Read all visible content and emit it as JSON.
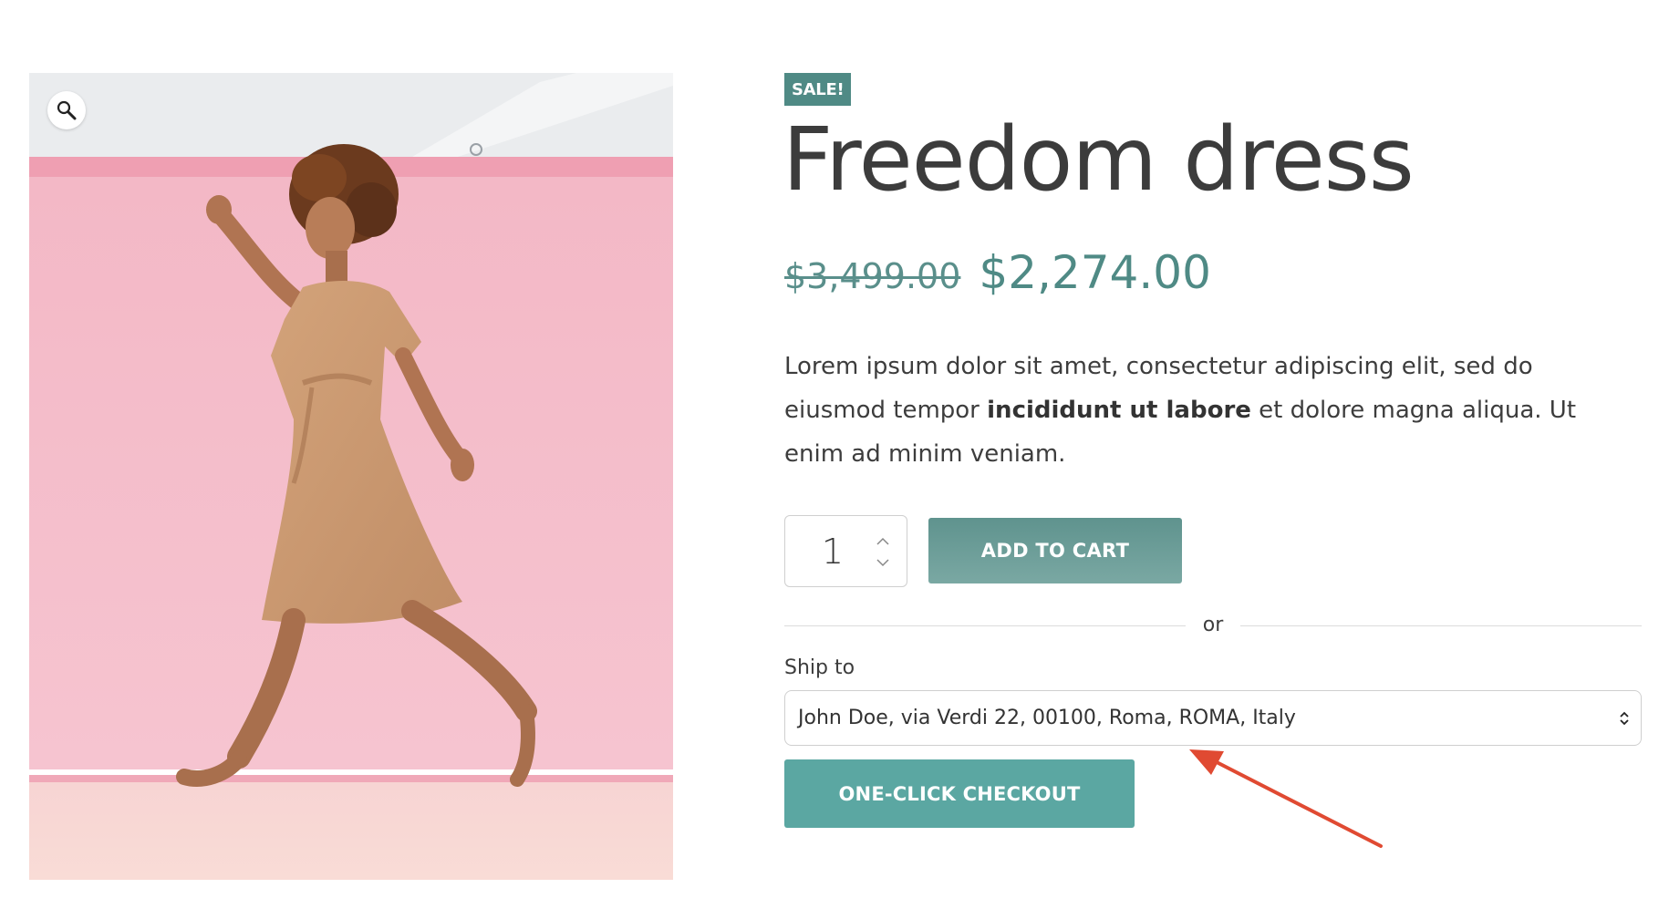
{
  "gallery": {
    "zoom_icon": "magnifier-icon",
    "image_alt": "woman-jumping-pink-wall-photo"
  },
  "product": {
    "badge": "SALE!",
    "title": "Freedom dress",
    "price_old": "$3,499.00",
    "price_new": "$2,274.00",
    "description": {
      "part1": "Lorem ipsum dolor sit amet, consectetur adipiscing elit, sed do eiusmod tempor ",
      "bold": "incididunt ut labore",
      "part2": " et dolore magna aliqua. Ut enim ad minim veniam."
    }
  },
  "cart": {
    "quantity": "1",
    "qty_up_icon": "chevron-up-icon",
    "qty_down_icon": "chevron-down-icon",
    "add_to_cart_label": "ADD TO CART"
  },
  "divider": {
    "text": "or"
  },
  "shipping": {
    "label": "Ship to",
    "selected": "John Doe, via Verdi 22, 00100, Roma, ROMA, Italy",
    "chevron_icon": "updown-chevron-icon"
  },
  "checkout": {
    "label": "ONE-CLICK CHECKOUT"
  },
  "colors": {
    "accent": "#4f8a85",
    "add_to_cart": "#6a9b96",
    "checkout": "#5ba7a2",
    "annotation_arrow": "#e04a32",
    "photo_background": "#f6c8d2"
  }
}
